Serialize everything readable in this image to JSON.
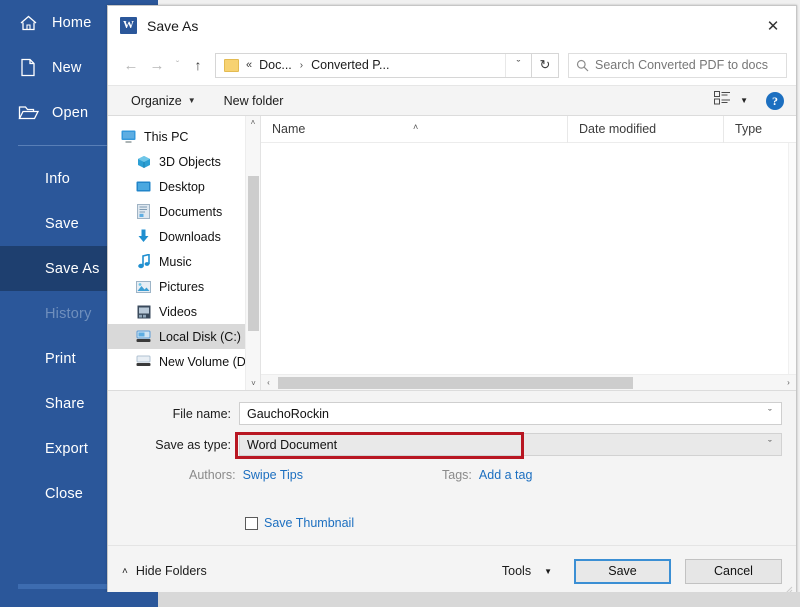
{
  "backstage": {
    "top_items": [
      {
        "label": "Home",
        "icon": "home-icon"
      },
      {
        "label": "New",
        "icon": "new-document-icon"
      },
      {
        "label": "Open",
        "icon": "open-folder-icon"
      }
    ],
    "commands": [
      {
        "label": "Info",
        "state": "normal"
      },
      {
        "label": "Save",
        "state": "normal"
      },
      {
        "label": "Save As",
        "state": "selected"
      },
      {
        "label": "History",
        "state": "disabled"
      },
      {
        "label": "Print",
        "state": "normal"
      },
      {
        "label": "Share",
        "state": "normal"
      },
      {
        "label": "Export",
        "state": "normal"
      },
      {
        "label": "Close",
        "state": "normal"
      }
    ],
    "accent_color": "#2b579a",
    "selected_color": "#1e3f6f"
  },
  "dialog": {
    "title": "Save As",
    "app_icon_letter": "W",
    "close_label": "✕",
    "nav": {
      "back_icon": "←",
      "forward_icon": "→",
      "recent_icon": "ˇ",
      "up_icon": "↑",
      "breadcrumb": {
        "chevrons": "«",
        "segments": [
          "Doc...",
          "Converted P..."
        ],
        "separator": "›",
        "dropdown_icon": "ˇ"
      },
      "refresh_icon": "↻",
      "search_placeholder": "Search Converted PDF to docs",
      "search_icon": "⚲"
    },
    "commandbar": {
      "organize_label": "Organize",
      "organize_caret": "▼",
      "new_folder_label": "New folder",
      "view_caret": "▼",
      "help_label": "?"
    },
    "tree": {
      "items": [
        {
          "label": "This PC",
          "icon": "monitor-icon",
          "indent": false,
          "selected": false
        },
        {
          "label": "3D Objects",
          "icon": "cube-icon",
          "indent": true,
          "selected": false
        },
        {
          "label": "Desktop",
          "icon": "desktop-icon",
          "indent": true,
          "selected": false
        },
        {
          "label": "Documents",
          "icon": "documents-icon",
          "indent": true,
          "selected": false
        },
        {
          "label": "Downloads",
          "icon": "download-arrow-icon",
          "indent": true,
          "selected": false
        },
        {
          "label": "Music",
          "icon": "music-note-icon",
          "indent": true,
          "selected": false
        },
        {
          "label": "Pictures",
          "icon": "picture-icon",
          "indent": true,
          "selected": false
        },
        {
          "label": "Videos",
          "icon": "video-icon",
          "indent": true,
          "selected": false
        },
        {
          "label": "Local Disk (C:)",
          "icon": "hard-drive-icon",
          "indent": true,
          "selected": true
        },
        {
          "label": "New Volume (D:",
          "icon": "hard-drive-icon",
          "indent": true,
          "selected": false
        }
      ],
      "scroll_up_icon": "˄",
      "scroll_down_icon": "˅"
    },
    "columns": {
      "name": "Name",
      "date_modified": "Date modified",
      "type": "Type",
      "sort_indicator": "˄"
    },
    "hscroll": {
      "left_icon": "‹",
      "right_icon": "›"
    },
    "form": {
      "file_name_label": "File name:",
      "file_name_value": "GauchoRockin",
      "save_as_type_label": "Save as type:",
      "save_as_type_value": "Word Document",
      "combo_caret": "ˇ",
      "authors_label": "Authors:",
      "authors_value": "Swipe Tips",
      "tags_label": "Tags:",
      "tags_value": "Add a tag",
      "save_thumbnail_label": "Save Thumbnail",
      "highlight_color": "#b81622"
    },
    "footer": {
      "hide_folders_label": "Hide Folders",
      "hide_folders_caret": "˄",
      "tools_label": "Tools",
      "tools_caret": "▼",
      "save_label": "Save",
      "cancel_label": "Cancel"
    }
  }
}
